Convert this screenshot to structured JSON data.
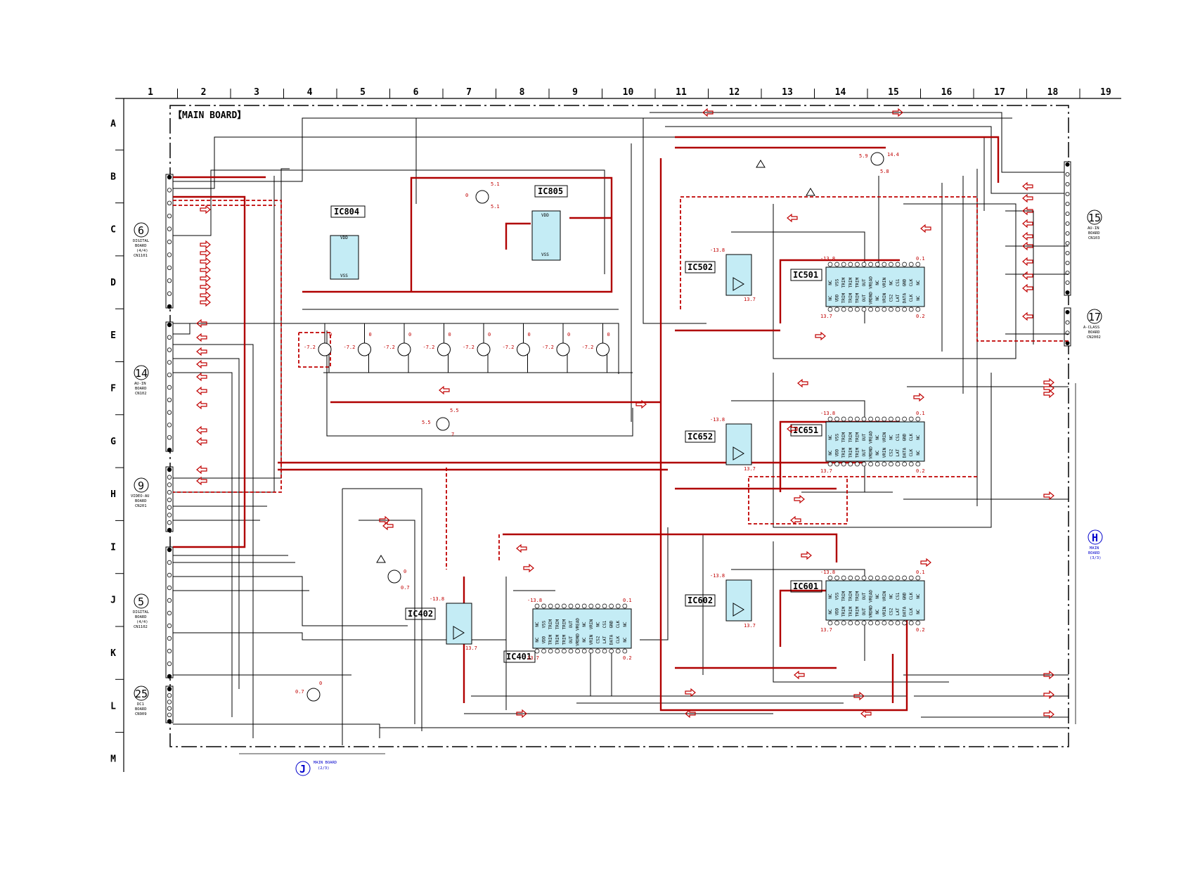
{
  "board_title": "【MAIN BOARD】",
  "columns": [
    "1",
    "2",
    "3",
    "4",
    "5",
    "6",
    "7",
    "8",
    "9",
    "10",
    "11",
    "12",
    "13",
    "14",
    "15",
    "16",
    "17",
    "18",
    "19"
  ],
  "rows": [
    "A",
    "B",
    "C",
    "D",
    "E",
    "F",
    "G",
    "H",
    "I",
    "J",
    "K",
    "L",
    "M"
  ],
  "ics": [
    {
      "id": "IC804",
      "label": "IC804"
    },
    {
      "id": "IC805",
      "label": "IC805"
    },
    {
      "id": "IC502",
      "label": "IC502"
    },
    {
      "id": "IC501",
      "label": "IC501"
    },
    {
      "id": "IC652",
      "label": "IC652"
    },
    {
      "id": "IC651",
      "label": "IC651"
    },
    {
      "id": "IC602",
      "label": "IC602"
    },
    {
      "id": "IC601",
      "label": "IC601"
    },
    {
      "id": "IC402",
      "label": "IC402"
    },
    {
      "id": "IC401",
      "label": "IC401"
    }
  ],
  "connectors_left": [
    {
      "num": "6",
      "line1": "DIGITAL",
      "line2": "BOARD",
      "line3": "(4/4)",
      "line4": "CN1101"
    },
    {
      "num": "14",
      "line1": "AU-IN",
      "line2": "BOARD",
      "line3": "CN102",
      "line4": ""
    },
    {
      "num": "9",
      "line1": "VIDEO-AU",
      "line2": "BOARD",
      "line3": "CN201",
      "line4": ""
    },
    {
      "num": "5",
      "line1": "DIGITAL",
      "line2": "BOARD",
      "line3": "(4/4)",
      "line4": "CN1102"
    },
    {
      "num": "25",
      "line1": "DC1",
      "line2": "BOARD",
      "line3": "CN909",
      "line4": ""
    }
  ],
  "connectors_right": [
    {
      "num": "15",
      "line1": "AU-IN",
      "line2": "BOARD",
      "line3": "CN103"
    },
    {
      "num": "17",
      "line1": "A-CLASS",
      "line2": "BOARD",
      "line3": "CN2002"
    }
  ],
  "ref_H": {
    "letter": "H",
    "line1": "MAIN",
    "line2": "BOARD",
    "line3": "(3/3)"
  },
  "ref_J": {
    "letter": "J",
    "line1": "MAIN BOARD",
    "line2": "(2/3)"
  },
  "pin_names_top": [
    "NC",
    "VSS",
    "TRIM",
    "TRIM",
    "TRIM",
    "OUT",
    "VREAD",
    "NC",
    "VRIN",
    "NC",
    "CS1",
    "GND",
    "CLK",
    "NC"
  ],
  "pin_names_bot": [
    "NC",
    "VDD",
    "TRIM",
    "TRIM",
    "TRIM",
    "OUT",
    "VRDND",
    "NC",
    "VRIN",
    "CS2",
    "LAT",
    "DATA",
    "CLK",
    "NC"
  ],
  "voltages": {
    "v_neg138": "-13.8",
    "v_137": "13.7",
    "v_51": "5.1",
    "v_0": "0",
    "v_neg72": "-7.2",
    "v_55": "5.5",
    "v_7": "7",
    "v_59": "5.9",
    "v_144": "14.4",
    "v_58": "5.8",
    "v_02": "0.2",
    "v_01": "0.1",
    "v_07": "0.7"
  }
}
